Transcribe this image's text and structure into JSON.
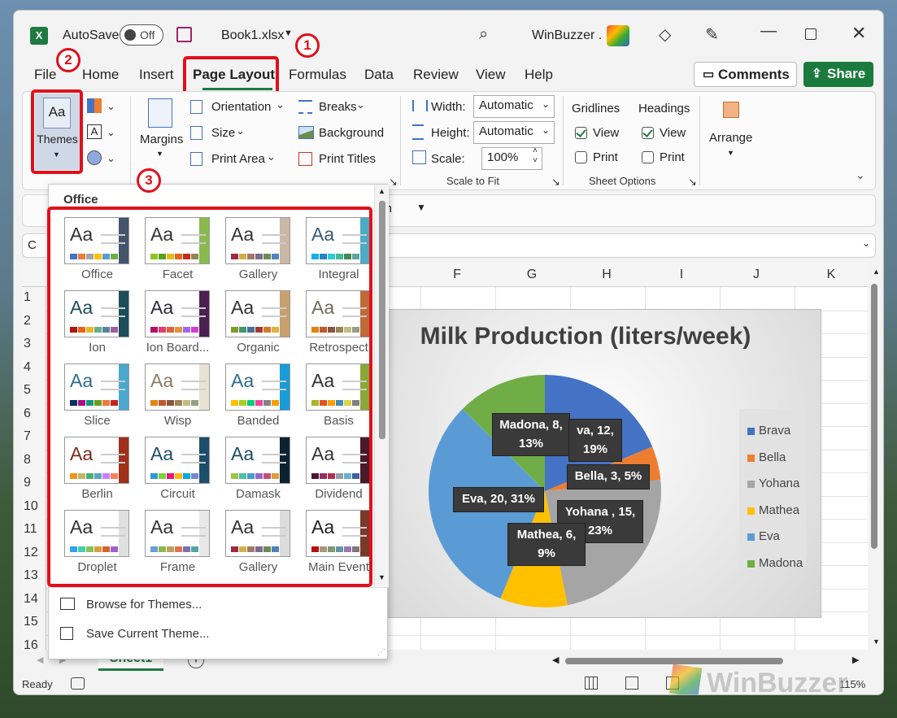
{
  "titlebar": {
    "autosave_label": "AutoSave",
    "autosave_state": "Off",
    "filename": "Book1.xlsx",
    "account": "WinBuzzer ."
  },
  "tabs": [
    "File",
    "Home",
    "Insert",
    "Page Layout",
    "Formulas",
    "Data",
    "Review",
    "View",
    "Help"
  ],
  "buttons": {
    "comments": "Comments",
    "share": "Share"
  },
  "badges": {
    "one": "1",
    "two": "2",
    "three": "3"
  },
  "ribbon": {
    "themes": "Themes",
    "margins": "Margins",
    "orientation": "Orientation",
    "size": "Size",
    "print_area": "Print Area",
    "breaks": "Breaks",
    "background": "Background",
    "print_titles": "Print Titles",
    "width_label": "Width:",
    "width_value": "Automatic",
    "height_label": "Height:",
    "height_value": "Automatic",
    "scale_label": "Scale:",
    "scale_value": "100%",
    "scale_to_fit": "Scale to Fit",
    "gridlines": "Gridlines",
    "headings": "Headings",
    "view": "View",
    "print": "Print",
    "sheet_options": "Sheet Options",
    "arrange": "Arrange"
  },
  "formula_partial": "ugh",
  "columns": [
    "E",
    "F",
    "G",
    "H",
    "I",
    "J",
    "K"
  ],
  "rows": [
    "1",
    "2",
    "3",
    "4",
    "5",
    "6",
    "7",
    "8",
    "9",
    "10",
    "11",
    "12",
    "13",
    "14",
    "15",
    "16"
  ],
  "name_box_partial": "C",
  "themes_panel": {
    "section": "Office",
    "themes": [
      "Office",
      "Facet",
      "Gallery",
      "Integral",
      "Ion",
      "Ion Board...",
      "Organic",
      "Retrospect",
      "Slice",
      "Wisp",
      "Banded",
      "Basis",
      "Berlin",
      "Circuit",
      "Damask",
      "Dividend",
      "Droplet",
      "Frame",
      "Gallery",
      "Main Event"
    ],
    "browse": "Browse for Themes...",
    "save": "Save Current Theme..."
  },
  "sheet_tab": "Sheet1",
  "status": {
    "ready": "Ready",
    "zoom": "115%"
  },
  "watermark": "WinBuzzer",
  "chart_data": {
    "type": "pie",
    "title": "Milk Production (liters/week)",
    "categories": [
      "Brava",
      "Bella",
      "Yohana",
      "Mathea",
      "Eva",
      "Madona"
    ],
    "values": [
      12,
      3,
      15,
      6,
      20,
      8
    ],
    "percents": [
      "19%",
      "5%",
      "23%",
      "9%",
      "31%",
      "13%"
    ],
    "colors": [
      "#4472c4",
      "#ed7d31",
      "#a5a5a5",
      "#ffc000",
      "#5b9bd5",
      "#70ad47"
    ],
    "data_labels": [
      "va, 12,",
      "19%",
      "Bella, 3, 5%",
      "Yohana , 15,",
      "23%",
      "Mathea, 6,",
      "9%",
      "Eva, 20, 31%",
      "Madona, 8,",
      "13%"
    ],
    "legend_position": "right"
  }
}
